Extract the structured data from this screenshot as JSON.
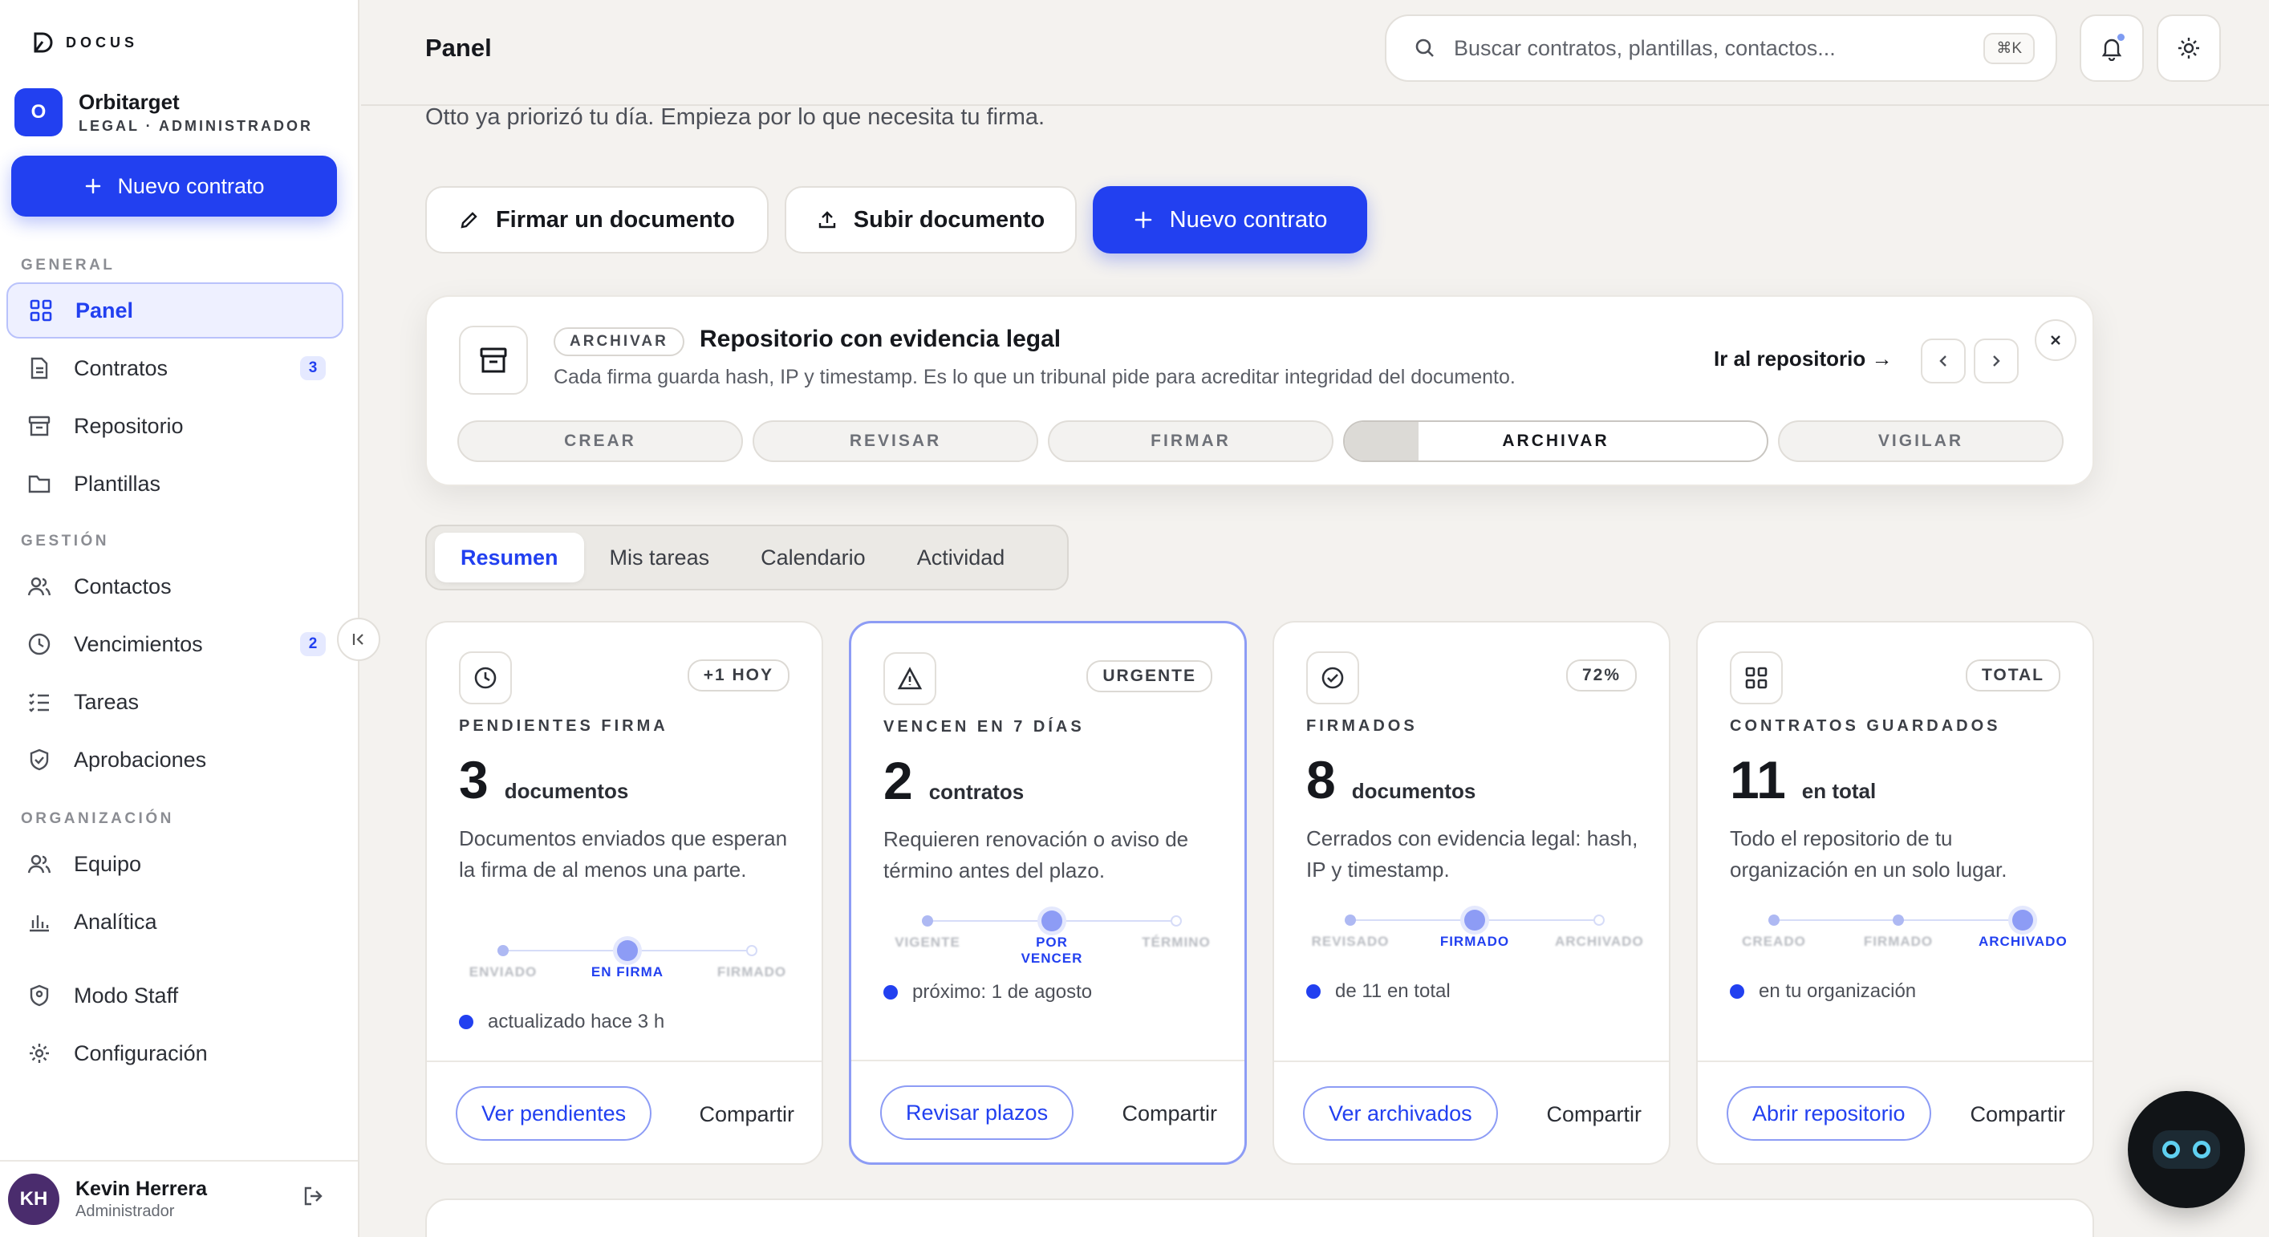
{
  "app": {
    "logo_text": "DOCUS"
  },
  "org": {
    "initial": "O",
    "name": "Orbitarget",
    "role": "LEGAL · ADMINISTRADOR"
  },
  "sidebar": {
    "new_button": "Nuevo contrato",
    "sections": [
      "GENERAL",
      "GESTIÓN",
      "ORGANIZACIÓN"
    ],
    "items": [
      {
        "label": "Panel",
        "icon": "grid-icon"
      },
      {
        "label": "Contratos",
        "icon": "document-icon",
        "badge": "3"
      },
      {
        "label": "Repositorio",
        "icon": "archive-icon"
      },
      {
        "label": "Plantillas",
        "icon": "folder-icon"
      },
      {
        "label": "Contactos",
        "icon": "users-icon"
      },
      {
        "label": "Vencimientos",
        "icon": "clock-icon",
        "badge": "2"
      },
      {
        "label": "Tareas",
        "icon": "checklist-icon"
      },
      {
        "label": "Aprobaciones",
        "icon": "shield-check-icon"
      },
      {
        "label": "Equipo",
        "icon": "team-icon"
      },
      {
        "label": "Analítica",
        "icon": "bar-chart-icon"
      },
      {
        "label": "Modo Staff",
        "icon": "shield-icon"
      },
      {
        "label": "Configuración",
        "icon": "gear-icon"
      }
    ]
  },
  "user": {
    "initials": "KH",
    "name": "Kevin Herrera",
    "role": "Administrador"
  },
  "header": {
    "title": "Panel",
    "search_placeholder": "Buscar contratos, plantillas, contactos...",
    "search_shortcut": "⌘K"
  },
  "main": {
    "subtitle": "Otto ya priorizó tu día. Empieza por lo que necesita tu firma.",
    "actions": [
      "Firmar un documento",
      "Subir documento",
      "Nuevo contrato"
    ],
    "banner": {
      "tag": "ARCHIVAR",
      "title": "Repositorio con evidencia legal",
      "description": "Cada firma guarda hash, IP y timestamp. Es lo que un tribunal pide para acreditar integridad del documento.",
      "link": "Ir al repositorio →",
      "steps": [
        "CREAR",
        "REVISAR",
        "FIRMAR",
        "ARCHIVAR",
        "VIGILAR"
      ],
      "active_step": "ARCHIVAR"
    },
    "tabs": [
      "Resumen",
      "Mis tareas",
      "Calendario",
      "Actividad"
    ],
    "active_tab": "Resumen",
    "cards": [
      {
        "icon": "clock-icon",
        "badge": "+1 HOY",
        "label": "PENDIENTES FIRMA",
        "value": "3",
        "unit": "documentos",
        "description": "Documentos enviados que esperan la firma de al menos una parte.",
        "timeline": [
          "ENVIADO",
          "EN FIRMA",
          "FIRMADO"
        ],
        "meta": "actualizado hace 3 h",
        "primary": "Ver pendientes",
        "secondary": "Compartir"
      },
      {
        "icon": "warning-icon",
        "badge": "URGENTE",
        "label": "VENCEN EN 7 DÍAS",
        "value": "2",
        "unit": "contratos",
        "description": "Requieren renovación o aviso de término antes del plazo.",
        "timeline": [
          "VIGENTE",
          "POR VENCER",
          "TÉRMINO"
        ],
        "meta": "próximo: 1 de agosto",
        "primary": "Revisar plazos",
        "secondary": "Compartir"
      },
      {
        "icon": "check-circle-icon",
        "badge": "72%",
        "label": "FIRMADOS",
        "value": "8",
        "unit": "documentos",
        "description": "Cerrados con evidencia legal: hash, IP y timestamp.",
        "timeline": [
          "REVISADO",
          "FIRMADO",
          "ARCHIVADO"
        ],
        "meta": "de 11 en total",
        "primary": "Ver archivados",
        "secondary": "Compartir"
      },
      {
        "icon": "grid-icon",
        "badge": "TOTAL",
        "label": "CONTRATOS GUARDADOS",
        "value": "11",
        "unit": "en total",
        "description": "Todo el repositorio de tu organización en un solo lugar.",
        "timeline": [
          "CREADO",
          "FIRMADO",
          "ARCHIVADO"
        ],
        "meta": "en tu organización",
        "primary": "Abrir repositorio",
        "secondary": "Compartir"
      }
    ]
  },
  "colors": {
    "accent": "#2240f0",
    "accent_soft": "#8d9cf5",
    "background": "#f4f2ef"
  }
}
